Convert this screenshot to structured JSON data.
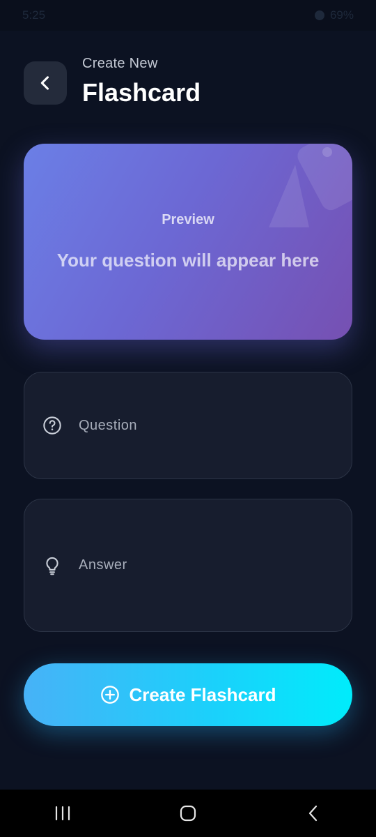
{
  "status_bar": {
    "time": "5:25",
    "battery": "69%"
  },
  "header": {
    "subtitle": "Create New",
    "title": "Flashcard"
  },
  "preview": {
    "label": "Preview",
    "placeholder": "Your question will appear here"
  },
  "form": {
    "question_placeholder": "Question",
    "answer_placeholder": "Answer"
  },
  "actions": {
    "create_label": "Create Flashcard"
  },
  "icons": {
    "back": "chevron-left-icon",
    "question": "help-circle-icon",
    "answer": "lightbulb-icon",
    "create": "plus-circle-icon",
    "nav_recent": "recent-apps-icon",
    "nav_home": "home-icon",
    "nav_back": "back-icon"
  },
  "colors": {
    "background": "#0c1222",
    "card_gradient_start": "#6b7fe6",
    "card_gradient_end": "#7650b2",
    "button_gradient_start": "#47b2f7",
    "button_gradient_end": "#00ecfb",
    "field_background": "#171d2e"
  }
}
